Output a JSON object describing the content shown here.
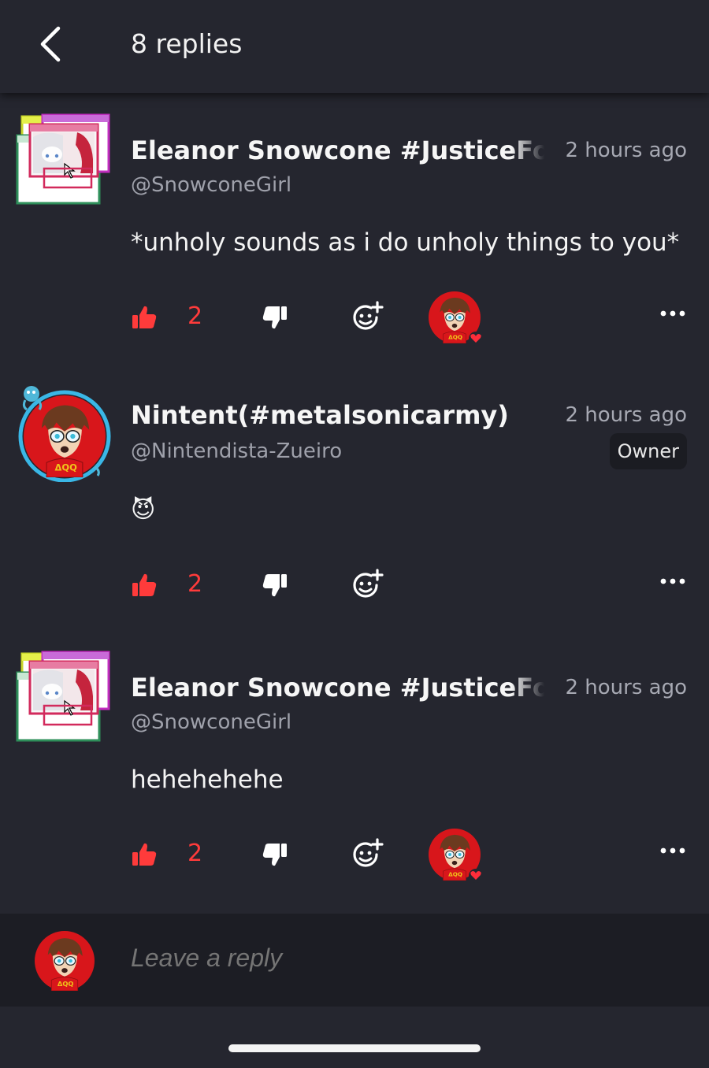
{
  "header": {
    "title": "8 replies",
    "back_icon": "chevron-left-icon"
  },
  "comments": [
    {
      "name": "Eleanor Snowcone #JusticeForEleanor",
      "handle": "@SnowconeGirl",
      "time": "2 hours ago",
      "text": "*unholy sounds as i do unholy things to you*",
      "likes": "2",
      "badge": "",
      "reactor": true,
      "avatar_icon": "retro-windows-anime-avatar"
    },
    {
      "name": "Nintent(#metalsonicarmy)",
      "handle": "@Nintendista-Zueiro",
      "time": "2 hours ago",
      "text": "",
      "emoji": "😈",
      "likes": "2",
      "badge": "Owner",
      "reactor": false,
      "avatar_icon": "cartoon-boy-avatar"
    },
    {
      "name": "Eleanor Snowcone #JusticeForEleanor",
      "handle": "@SnowconeGirl",
      "time": "2 hours ago",
      "text": "hehehehehe",
      "likes": "2",
      "badge": "",
      "reactor": true,
      "avatar_icon": "retro-windows-anime-avatar"
    }
  ],
  "reply_bar": {
    "placeholder": "Leave a reply"
  },
  "colors": {
    "background": "#25262f",
    "accent": "#ff3b3b",
    "reply_bar": "#1c1d24"
  }
}
